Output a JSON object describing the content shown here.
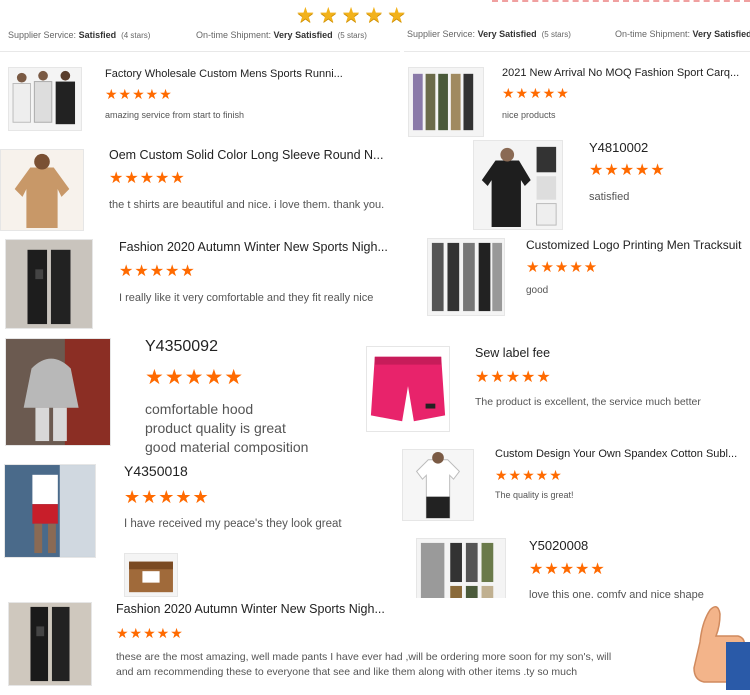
{
  "top_rating": {
    "stars": "★★★★★",
    "icon": "star-icon"
  },
  "header": [
    {
      "label": "Supplier Service:",
      "value": "Satisfied",
      "stars": "(4 stars)"
    },
    {
      "label": "On-time Shipment:",
      "value": "Very Satisfied",
      "stars": "(5 stars)"
    },
    {
      "label": "Supplier Service:",
      "value": "Very Satisfied",
      "stars": "(5 stars)"
    },
    {
      "label": "On-time Shipment:",
      "value": "Very Satisfied",
      "stars": ""
    }
  ],
  "stars_text": "★★★★★",
  "reviews": [
    {
      "title": "Factory Wholesale Custom Mens Sports Runni...",
      "text": "amazing service from start to finish",
      "rating": 5,
      "thumb_icon": "sleeveless-shirts-image"
    },
    {
      "title": "2021 New Arrival No MOQ Fashion Sport Carq...",
      "text": "nice products",
      "rating": 5,
      "thumb_icon": "cargo-pants-image"
    },
    {
      "title": "Oem Custom Solid Color Long Sleeve Round N...",
      "text": "the t shirts are beautiful and nice.  i love them.  thank you.",
      "rating": 5,
      "thumb_icon": "long-sleeve-shirt-image"
    },
    {
      "title": "Y4810002",
      "text": "satisfied",
      "rating": 5,
      "thumb_icon": "black-long-sleeve-image"
    },
    {
      "title": "Fashion 2020 Autumn Winter New Sports Nigh...",
      "text": "I really like it very comfortable and they fit really nice",
      "rating": 5,
      "thumb_icon": "jogger-pants-image"
    },
    {
      "title": "Customized Logo Printing Men Tracksuit",
      "text": "good",
      "rating": 5,
      "thumb_icon": "tracksuit-pants-image"
    },
    {
      "title": "Y4350092",
      "text": "comfortable hood\nproduct quality is great\ngood material composition",
      "rating": 5,
      "thumb_icon": "hoodie-image"
    },
    {
      "title": "Sew label fee",
      "text": "The product is excellent, the service much better",
      "rating": 5,
      "thumb_icon": "pink-shorts-image"
    },
    {
      "title": "Custom Design Your Own Spandex Cotton Subl...",
      "text": "The quality is great!",
      "rating": 5,
      "thumb_icon": "white-tshirt-image"
    },
    {
      "title": "Y4350018",
      "text": "I have received my peace's they look great",
      "rating": 5,
      "thumb_icon": "shorts-man-image"
    },
    {
      "title": "Y5020008",
      "text": "love this one, comfy and nice shape",
      "rating": 5,
      "thumb_icon": "multi-pants-image"
    },
    {
      "title": "Fashion 2020 Autumn Winter New Sports Nigh...",
      "text": "these are the most amazing, well made pants I have ever had ,will be ordering more soon for my son's, will\nand am recommending these to everyone that see and like them along with other items .ty so much",
      "rating": 5,
      "thumb_icon": "black-joggers-image"
    }
  ],
  "extra": {
    "package_icon": "package-box-image",
    "thumbs_up_icon": "thumbs-up-icon"
  },
  "colors": {
    "star": "#ff6a00",
    "gold": "#f2b21b"
  }
}
